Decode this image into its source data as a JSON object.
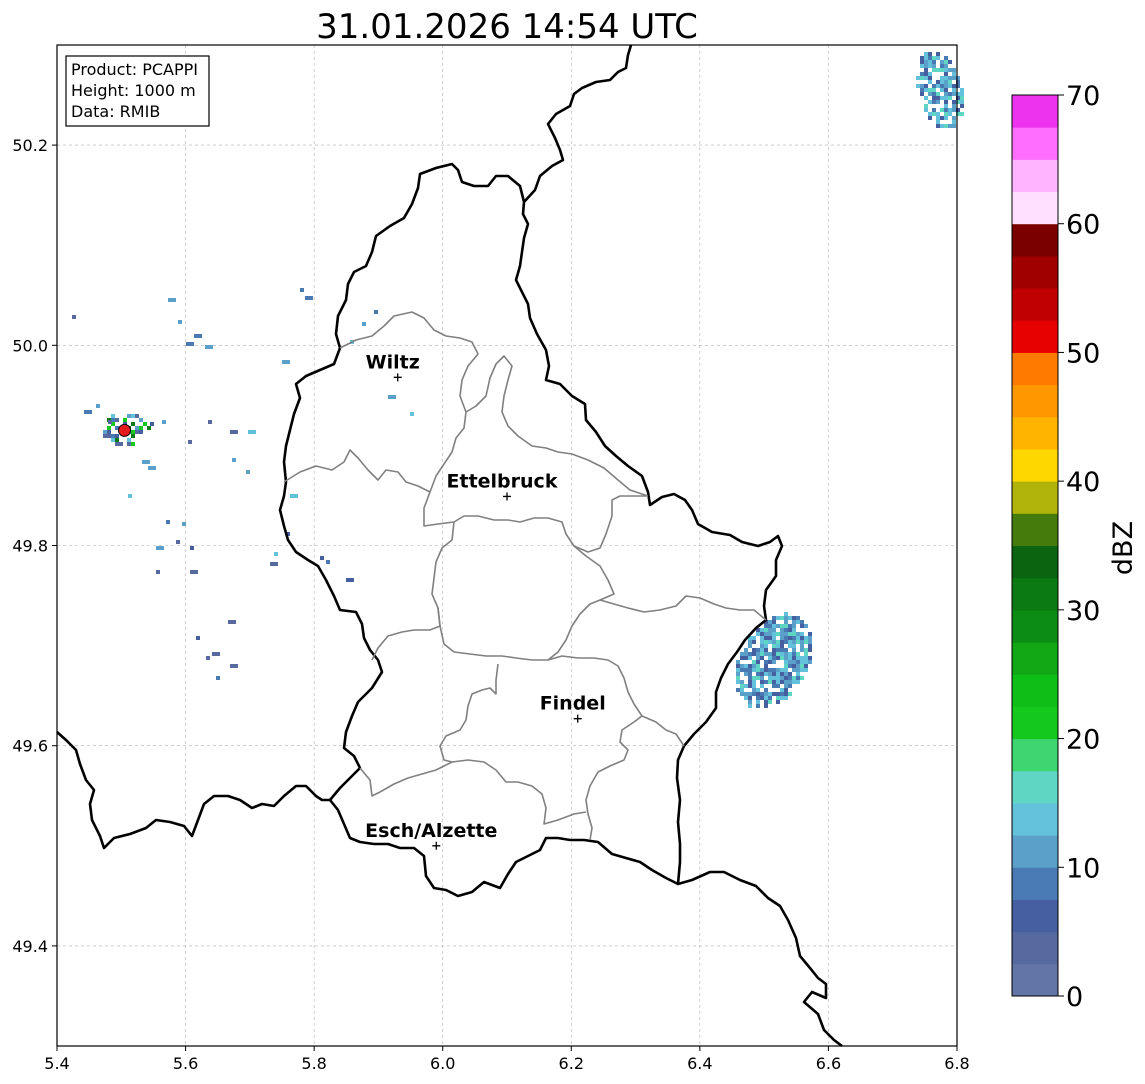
{
  "title": "31.01.2026 14:54 UTC",
  "info_box": {
    "lines": [
      "Product: PCAPPI",
      "Height: 1000 m",
      "Data: RMIB"
    ]
  },
  "map": {
    "x_ticks": [
      5.4,
      5.6,
      5.8,
      6.0,
      6.2,
      6.4,
      6.6,
      6.8
    ],
    "y_ticks": [
      49.4,
      49.6,
      49.8,
      50.0,
      50.2
    ],
    "x_labels": [
      "5.4",
      "5.6",
      "5.8",
      "6.0",
      "6.2",
      "6.4",
      "6.6",
      "6.8"
    ],
    "y_labels": [
      "49.4",
      "49.6",
      "49.8",
      "50.0",
      "50.2"
    ],
    "lon_range": [
      5.4,
      6.8
    ],
    "lat_range": [
      49.3,
      50.3
    ],
    "gridlines": true,
    "radar_site": {
      "lon": 5.505,
      "lat": 49.915,
      "color": "#e41a1c"
    },
    "cities": [
      {
        "name": "Wiltz",
        "lon": 5.93,
        "lat": 49.968
      },
      {
        "name": "Ettelbruck",
        "lon": 6.1,
        "lat": 49.849
      },
      {
        "name": "Findel",
        "lon": 6.21,
        "lat": 49.627
      },
      {
        "name": "Esch/Alzette",
        "lon": 5.99,
        "lat": 49.5
      }
    ],
    "precip_cells": [
      {
        "region": "east",
        "lon": [
          6.46,
          6.57
        ],
        "lat": [
          49.63,
          49.73
        ]
      },
      {
        "region": "northeast",
        "lon": [
          6.75,
          6.8
        ],
        "lat": [
          50.22,
          50.3
        ]
      },
      {
        "region": "radar-clutter",
        "lon": [
          5.44,
          5.58
        ],
        "lat": [
          49.86,
          49.94
        ]
      }
    ]
  },
  "colorbar": {
    "label": "dBZ",
    "min": 0,
    "max": 70,
    "ticks": [
      0,
      10,
      20,
      30,
      40,
      50,
      60,
      70
    ],
    "tick_labels": [
      "0",
      "10",
      "20",
      "30",
      "40",
      "50",
      "60",
      "70"
    ],
    "colors": [
      "#6374a6",
      "#566aa0",
      "#465fa0",
      "#4a7ab4",
      "#5aa0c8",
      "#64c1dc",
      "#5fd6c4",
      "#3dd670",
      "#14c81e",
      "#10be18",
      "#10a614",
      "#0c8c14",
      "#0b7a12",
      "#0a6410",
      "#457a0c",
      "#b0b40a",
      "#ffd700",
      "#ffb400",
      "#ff9800",
      "#ff7b00",
      "#e60000",
      "#c00000",
      "#a00000",
      "#7a0000",
      "#ffe0ff",
      "#ffb4ff",
      "#ff6eff",
      "#ee33ee"
    ]
  }
}
